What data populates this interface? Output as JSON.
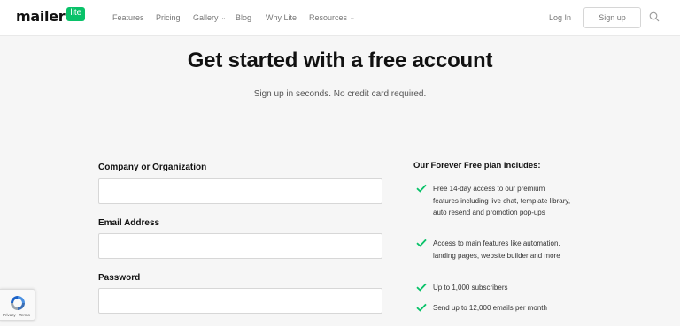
{
  "header": {
    "logo": {
      "text": "mailer",
      "badge": "lite"
    },
    "nav": [
      {
        "label": "Features"
      },
      {
        "label": "Pricing"
      },
      {
        "label": "Gallery",
        "has_caret": true
      },
      {
        "label": "Blog"
      },
      {
        "label": "Why Lite"
      },
      {
        "label": "Resources",
        "has_caret": true
      }
    ],
    "login_label": "Log In",
    "signup_label": "Sign up"
  },
  "main": {
    "title": "Get started with a free account",
    "subtitle": "Sign up in seconds. No credit card required."
  },
  "form": {
    "company_label": "Company or Organization",
    "company_value": "",
    "email_label": "Email Address",
    "email_value": "",
    "password_label": "Password",
    "password_value": ""
  },
  "plan": {
    "title": "Our Forever Free plan includes:",
    "items": [
      "Free 14-day access to our premium features including live chat, template library, auto resend and promotion pop-ups",
      "Access to main features like automation, landing pages, website builder and more",
      "Up to 1,000 subscribers",
      "Send up to 12,000 emails per month"
    ]
  },
  "recaptcha": {
    "text": "Privacy - Terms"
  },
  "colors": {
    "brand_green": "#09c269",
    "check_green": "#09c269"
  }
}
